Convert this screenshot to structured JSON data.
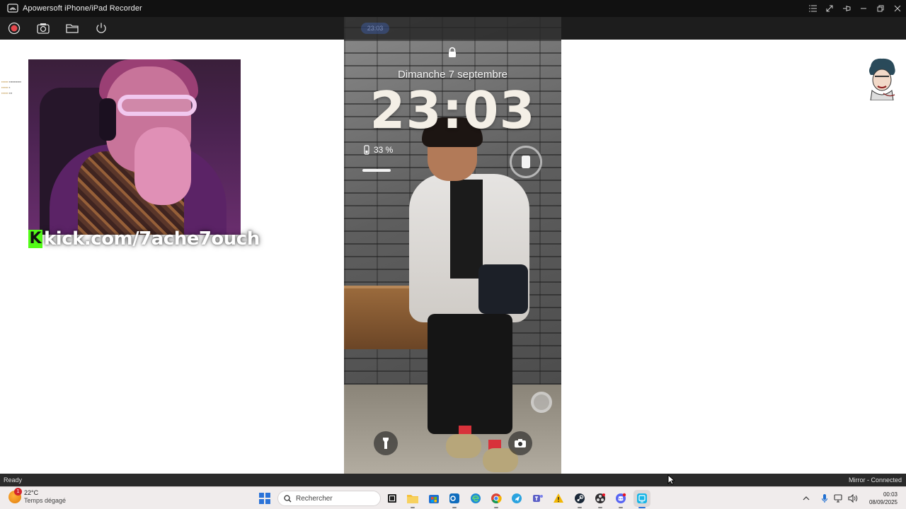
{
  "window": {
    "title": "Apowersoft iPhone/iPad Recorder"
  },
  "colors": {
    "titlebar": "#111111",
    "toolbar": "#1d1d1d",
    "record_red": "#e5484d",
    "kick_green": "#53fc18",
    "windows_blue": "#2b73d8"
  },
  "toolbar": {
    "buttons": [
      {
        "icon": "record-icon"
      },
      {
        "icon": "screenshot-camera-icon"
      },
      {
        "icon": "folder-icon"
      },
      {
        "icon": "power-icon"
      }
    ]
  },
  "overlay": {
    "kick_url": "kick.com/7ache7ouch",
    "kick_logo_letter": "K"
  },
  "phone": {
    "date": "Dimanche 7 septembre",
    "time": "23:03",
    "battery": "33 %",
    "status_pill": "23:03"
  },
  "statusbar": {
    "left": "Ready",
    "right": "Mirror - Connected"
  },
  "taskbar": {
    "weather": {
      "temp": "22°C",
      "condition": "Temps dégagé",
      "badge": "1"
    },
    "search_placeholder": "Rechercher",
    "clock": {
      "time": "00:03",
      "date": "08/09/2025"
    }
  }
}
